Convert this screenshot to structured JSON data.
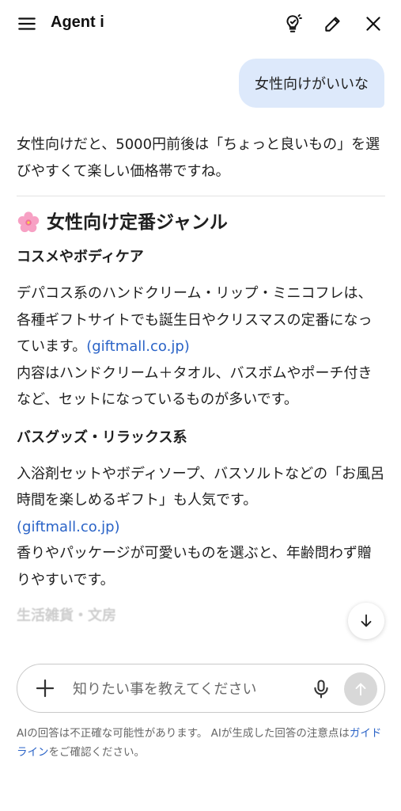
{
  "header": {
    "title": "Agent i",
    "menu_icon": "hamburger-menu-icon",
    "bulb_icon": "lightbulb-icon",
    "edit_icon": "pencil-icon",
    "close_icon": "close-icon"
  },
  "user_message": "女性向けがいいな",
  "response": {
    "intro": "女性向けだと、5000円前後は「ちょっと良いもの」を選びやすくて楽しい価格帯ですね。",
    "section_title": "女性向け定番ジャンル",
    "section_emoji": "cherry-blossom-icon",
    "subsections": [
      {
        "heading": "コスメやボディケア",
        "para1": "デパコス系のハンドクリーム・リップ・ミニコフレは、各種ギフトサイトでも誕生日やクリスマスの定番になっています。",
        "link": "(giftmall.co.jp)",
        "para2": "内容はハンドクリーム＋タオル、バスボムやポーチ付きなど、セットになっているものが多いです。"
      },
      {
        "heading": "バスグッズ・リラックス系",
        "para1": "入浴剤セットやボディソープ、バスソルトなどの「お風呂時間を楽しめるギフト」も人気です。",
        "link": "(giftmall.co.jp)",
        "para2": "香りやパッケージが可愛いものを選ぶと、年齢問わず贈りやすいです。"
      }
    ],
    "faded_heading": "生活雑貨・文房"
  },
  "composer": {
    "placeholder": "知りたい事を教えてください",
    "plus_icon": "plus-icon",
    "mic_icon": "microphone-icon",
    "send_icon": "arrow-up-icon"
  },
  "scroll_icon": "arrow-down-icon",
  "disclaimer": {
    "text1": "AIの回答は不正確な可能性があります。 AIが生成した回答の注意点は",
    "link": "ガイドライン",
    "text2": "をご確認ください。"
  },
  "colors": {
    "accent_link": "#2a63c7",
    "user_bubble": "#dde9fb",
    "send_disabled": "#d8d8d8"
  }
}
